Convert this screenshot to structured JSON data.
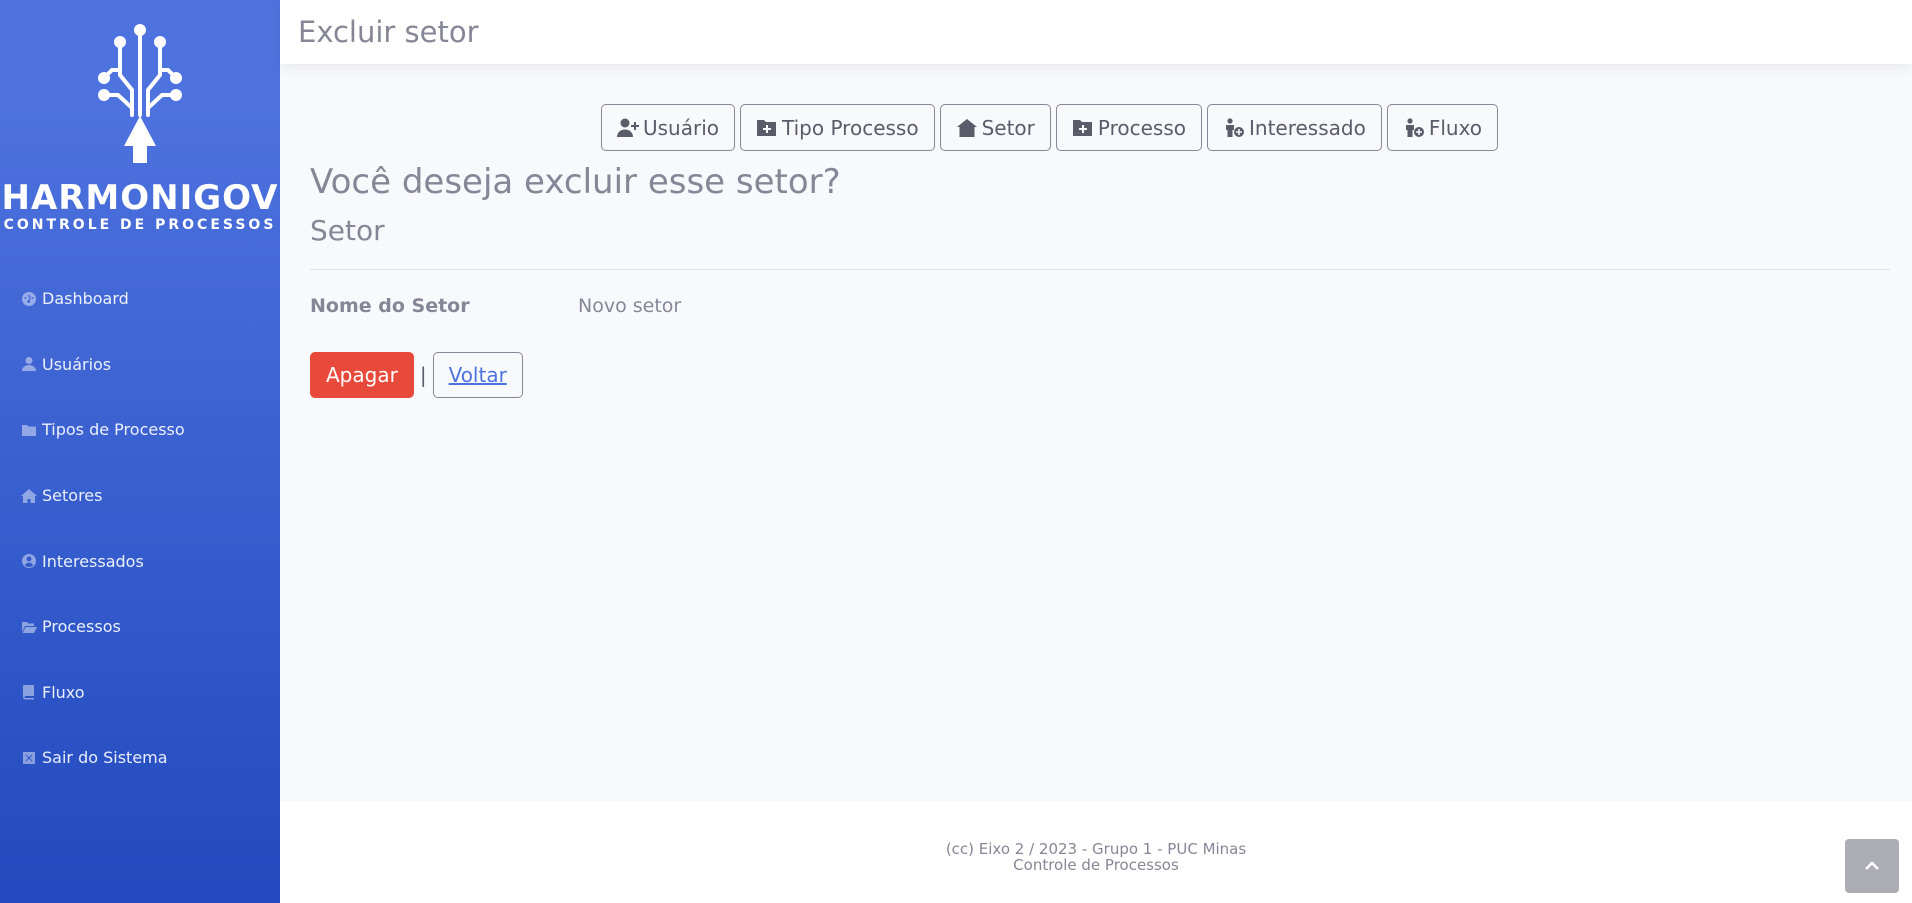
{
  "brand": {
    "name": "HARMONIGOV",
    "subtitle": "CONTROLE DE PROCESSOS"
  },
  "sidebar": {
    "items": [
      {
        "label": "Dashboard",
        "icon": "dashboard-icon"
      },
      {
        "label": "Usuários",
        "icon": "user-icon"
      },
      {
        "label": "Tipos de Processo",
        "icon": "folder-icon"
      },
      {
        "label": "Setores",
        "icon": "home-icon"
      },
      {
        "label": "Interessados",
        "icon": "user-circle-icon"
      },
      {
        "label": "Processos",
        "icon": "folder-open-icon"
      },
      {
        "label": "Fluxo",
        "icon": "book-icon"
      },
      {
        "label": "Sair do Sistema",
        "icon": "close-box-icon"
      }
    ]
  },
  "header": {
    "title": "Excluir setor"
  },
  "quick_actions": [
    {
      "label": "Usuário",
      "icon": "user-plus-icon"
    },
    {
      "label": "Tipo Processo",
      "icon": "folder-plus-icon"
    },
    {
      "label": "Setor",
      "icon": "house-plus-icon"
    },
    {
      "label": "Processo",
      "icon": "folder-plus-icon"
    },
    {
      "label": "Interessado",
      "icon": "person-plus-icon"
    },
    {
      "label": "Fluxo",
      "icon": "person-plus-icon"
    }
  ],
  "main": {
    "question": "Você deseja excluir esse setor?",
    "entity": "Setor",
    "field_label": "Nome do Setor",
    "field_value": "Novo setor",
    "delete_label": "Apagar",
    "separator": "|",
    "back_label": "Voltar"
  },
  "footer": {
    "line1": "(cc) Eixo 2 / 2023 - Grupo 1 - PUC Minas",
    "line2": "Controle de Processos"
  },
  "colors": {
    "sidebar_top": "#4e73df",
    "sidebar_bottom": "#224abe",
    "danger": "#e74a3b",
    "link": "#4e73df",
    "text_muted": "#858796"
  }
}
